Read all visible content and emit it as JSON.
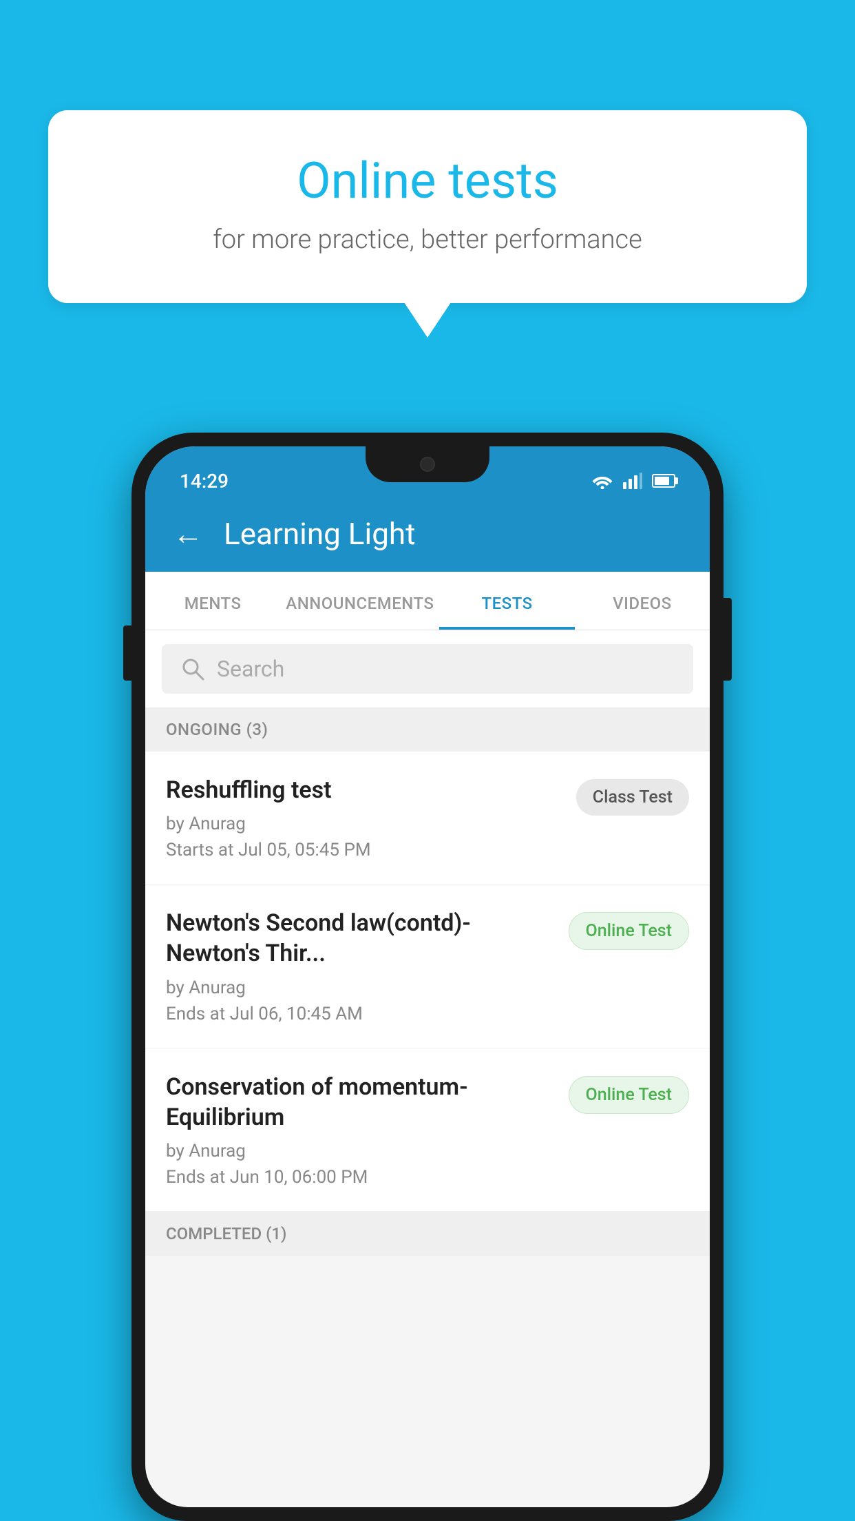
{
  "background": {
    "color": "#1ab8e8"
  },
  "speech_bubble": {
    "title": "Online tests",
    "subtitle": "for more practice, better performance"
  },
  "phone": {
    "status_bar": {
      "time": "14:29"
    },
    "app_bar": {
      "back_label": "←",
      "title": "Learning Light"
    },
    "tabs": [
      {
        "label": "MENTS",
        "active": false
      },
      {
        "label": "ANNOUNCEMENTS",
        "active": false
      },
      {
        "label": "TESTS",
        "active": true
      },
      {
        "label": "VIDEOS",
        "active": false
      }
    ],
    "search": {
      "placeholder": "Search"
    },
    "ongoing_section": {
      "label": "ONGOING (3)",
      "tests": [
        {
          "name": "Reshuffling test",
          "by": "by Anurag",
          "date": "Starts at  Jul 05, 05:45 PM",
          "badge": "Class Test",
          "badge_type": "class"
        },
        {
          "name": "Newton's Second law(contd)-Newton's Thir...",
          "by": "by Anurag",
          "date": "Ends at  Jul 06, 10:45 AM",
          "badge": "Online Test",
          "badge_type": "online"
        },
        {
          "name": "Conservation of momentum-Equilibrium",
          "by": "by Anurag",
          "date": "Ends at  Jun 10, 06:00 PM",
          "badge": "Online Test",
          "badge_type": "online"
        }
      ]
    },
    "completed_section": {
      "label": "COMPLETED (1)"
    }
  }
}
